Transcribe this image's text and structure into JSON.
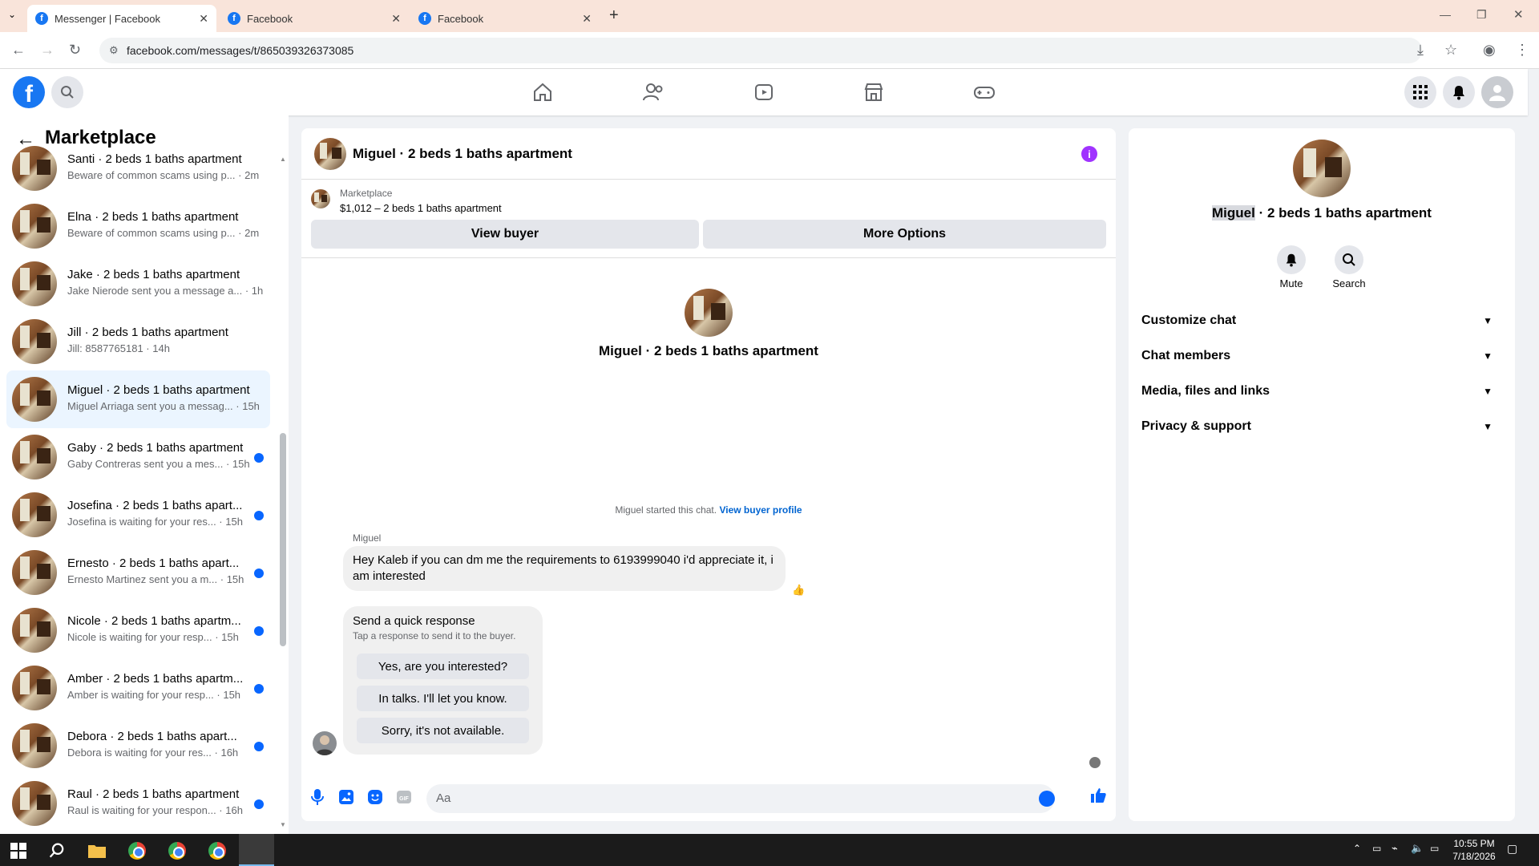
{
  "browser": {
    "tabs": [
      {
        "label": "Messenger | Facebook",
        "active": true
      },
      {
        "label": "Facebook",
        "active": false
      },
      {
        "label": "Facebook",
        "active": false
      }
    ],
    "url": "facebook.com/messages/t/865039326373085"
  },
  "sidebar": {
    "title": "Marketplace",
    "conversations": [
      {
        "name": "Santi · 2 beds 1 baths apartment",
        "preview": "Beware of common scams using p... · 2m",
        "unread": false,
        "selected": false
      },
      {
        "name": "Elna · 2 beds 1 baths apartment",
        "preview": "Beware of common scams using p... · 2m",
        "unread": false,
        "selected": false
      },
      {
        "name": "Jake · 2 beds 1 baths apartment",
        "preview": "Jake Nierode sent you a message a... · 1h",
        "unread": false,
        "selected": false
      },
      {
        "name": "Jill · 2 beds 1 baths apartment",
        "preview": "Jill: 8587765181 · 14h",
        "unread": false,
        "selected": false
      },
      {
        "name": "Miguel · 2 beds 1 baths apartment",
        "preview": "Miguel Arriaga sent you a messag... · 15h",
        "unread": false,
        "selected": true
      },
      {
        "name": "Gaby · 2 beds 1 baths apartment",
        "preview": "Gaby Contreras sent you a mes... · 15h",
        "unread": true,
        "selected": false
      },
      {
        "name": "Josefina · 2 beds 1 baths apart...",
        "preview": "Josefina is waiting for your res... · 15h",
        "unread": true,
        "selected": false
      },
      {
        "name": "Ernesto · 2 beds 1 baths apart...",
        "preview": "Ernesto Martinez sent you a m... · 15h",
        "unread": true,
        "selected": false
      },
      {
        "name": "Nicole · 2 beds 1 baths apartm...",
        "preview": "Nicole is waiting for your resp... · 15h",
        "unread": true,
        "selected": false
      },
      {
        "name": "Amber · 2 beds 1 baths apartm...",
        "preview": "Amber is waiting for your resp... · 15h",
        "unread": true,
        "selected": false
      },
      {
        "name": "Debora · 2 beds 1 baths apart...",
        "preview": "Debora is waiting for your res... · 16h",
        "unread": true,
        "selected": false
      },
      {
        "name": "Raul · 2 beds 1 baths apartment",
        "preview": "Raul is waiting for your respon... · 16h",
        "unread": true,
        "selected": false
      }
    ]
  },
  "chat": {
    "title": "Miguel · 2 beds 1 baths apartment",
    "listing": {
      "source": "Marketplace",
      "summary": "$1,012 – 2 beds 1 baths apartment",
      "view_buyer": "View buyer",
      "more_options": "More Options"
    },
    "intro_name": "Miguel · 2 beds 1 baths apartment",
    "started_text": "Miguel started this chat.",
    "view_buyer_profile": "View buyer profile",
    "sender": "Miguel",
    "message": "Hey Kaleb if you can dm me the requirements to 6193999040 i'd appreciate it, i am interested",
    "reaction": "👍",
    "quick_response": {
      "title": "Send a quick response",
      "subtitle": "Tap a response to send it to the buyer.",
      "options": [
        "Yes, are you interested?",
        "In talks. I'll let you know.",
        "Sorry, it's not available."
      ]
    },
    "composer_placeholder": "Aa"
  },
  "info_panel": {
    "name_first": "Miguel",
    "name_rest": " · 2 beds 1 baths apartment",
    "actions": [
      {
        "label": "Mute"
      },
      {
        "label": "Search"
      }
    ],
    "sections": [
      "Customize chat",
      "Chat members",
      "Media, files and links",
      "Privacy & support"
    ]
  },
  "taskbar": {
    "time": "10:55 PM",
    "date": "7/18/2026"
  },
  "colors": {
    "accent": "#0866ff",
    "fb_blue": "#1877f2",
    "info_purple": "#a033ff",
    "tab_bar": "#f9e4da"
  }
}
